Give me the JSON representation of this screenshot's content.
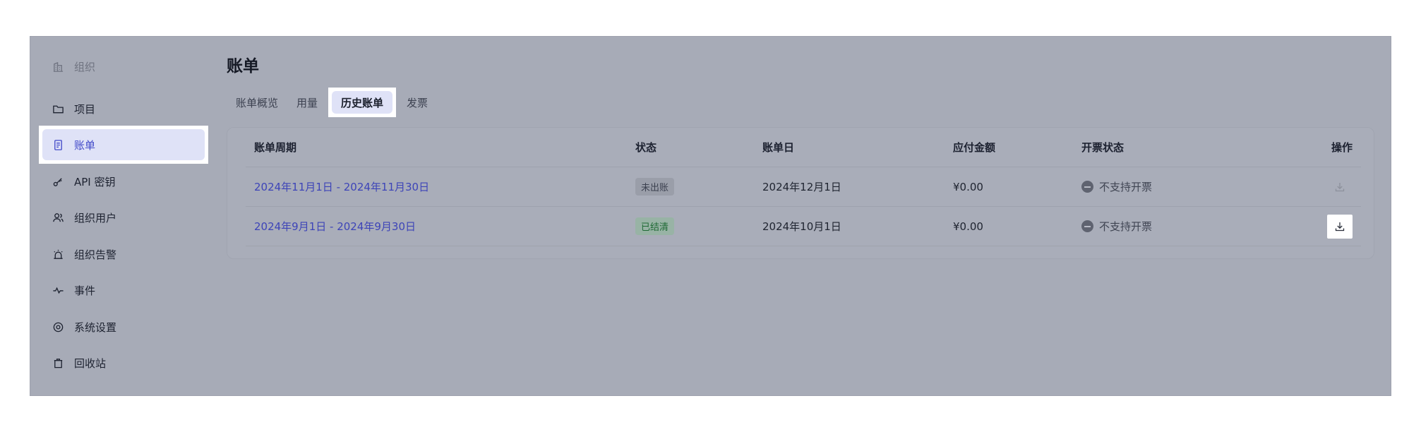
{
  "sidebar": {
    "items": [
      {
        "label": "组织",
        "icon": "building-icon"
      },
      {
        "label": "项目",
        "icon": "folder-icon"
      },
      {
        "label": "账单",
        "icon": "bill-icon",
        "active": true
      },
      {
        "label": "API 密钥",
        "icon": "key-icon"
      },
      {
        "label": "组织用户",
        "icon": "users-icon"
      },
      {
        "label": "组织告警",
        "icon": "alarm-icon"
      },
      {
        "label": "事件",
        "icon": "pulse-icon"
      },
      {
        "label": "系统设置",
        "icon": "settings-icon"
      },
      {
        "label": "回收站",
        "icon": "trash-icon"
      }
    ]
  },
  "main": {
    "title": "账单",
    "tabs": [
      {
        "label": "账单概览"
      },
      {
        "label": "用量"
      },
      {
        "label": "历史账单",
        "active": true
      },
      {
        "label": "发票"
      }
    ],
    "table": {
      "columns": [
        "账单周期",
        "状态",
        "账单日",
        "应付金额",
        "开票状态",
        "操作"
      ],
      "rows": [
        {
          "period": "2024年11月1日 - 2024年11月30日",
          "status": "未出账",
          "bill_date": "2024年12月1日",
          "amount": "¥0.00",
          "invoice_status": "不支持开票",
          "download_enabled": false
        },
        {
          "period": "2024年9月1日 - 2024年9月30日",
          "status": "已结清",
          "bill_date": "2024年10月1日",
          "amount": "¥0.00",
          "invoice_status": "不支持开票",
          "download_enabled": true
        }
      ]
    }
  },
  "colors": {
    "accent": "#4149c9",
    "link": "#3d44b8",
    "overlay": "#a7abb7",
    "active_bg": "#dfe2f7",
    "paid_green": "#1f6a35"
  }
}
